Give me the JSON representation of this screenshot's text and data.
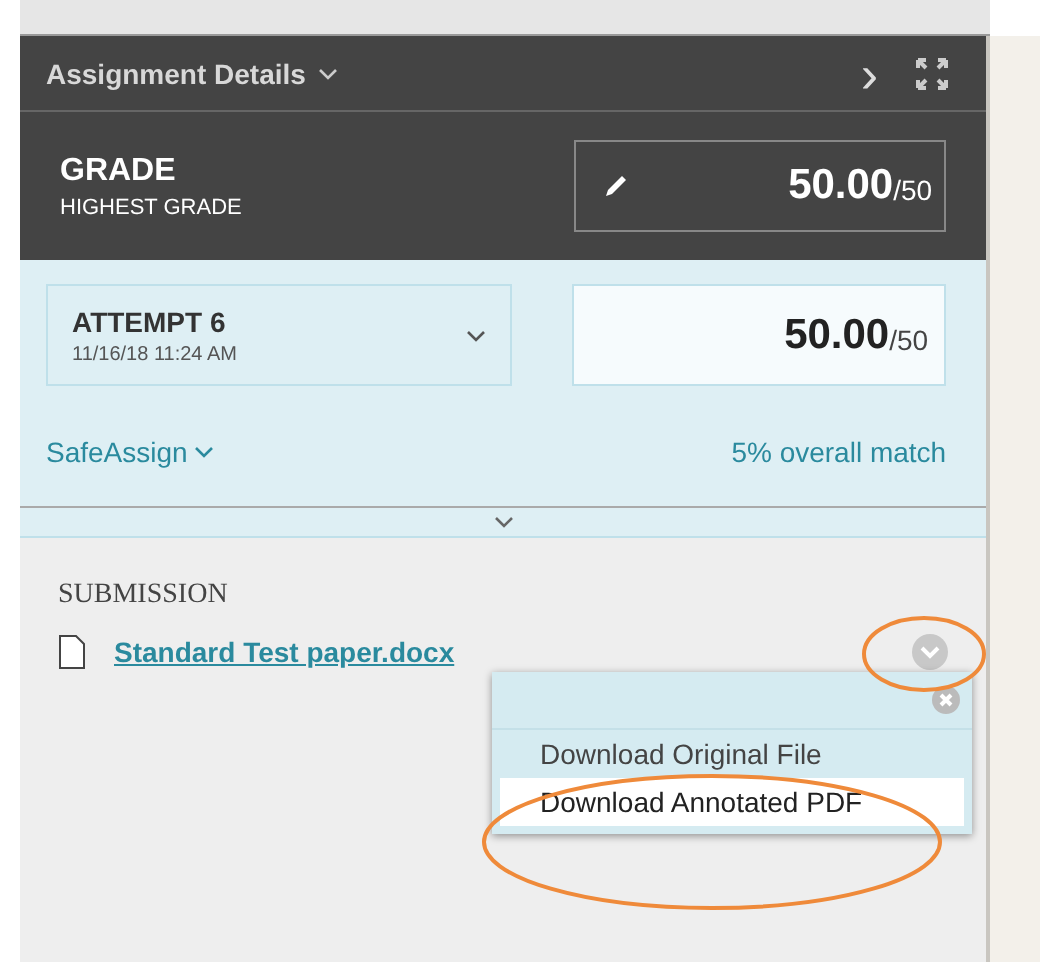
{
  "header": {
    "title": "Assignment Details",
    "expand_icon": "›"
  },
  "grade": {
    "label": "GRADE",
    "sublabel": "HIGHEST GRADE",
    "value": "50.00",
    "max": "/50"
  },
  "attempt": {
    "label": "ATTEMPT 6",
    "date": "11/16/18 11:24 AM",
    "value": "50.00",
    "max": "/50"
  },
  "safeassign": {
    "label": "SafeAssign",
    "match": "5% overall match"
  },
  "submission": {
    "label": "SUBMISSION",
    "file": "Standard Test paper.docx"
  },
  "menu": {
    "items": [
      {
        "label": "Download Original File",
        "selected": false
      },
      {
        "label": "Download Annotated PDF",
        "selected": true
      }
    ]
  }
}
